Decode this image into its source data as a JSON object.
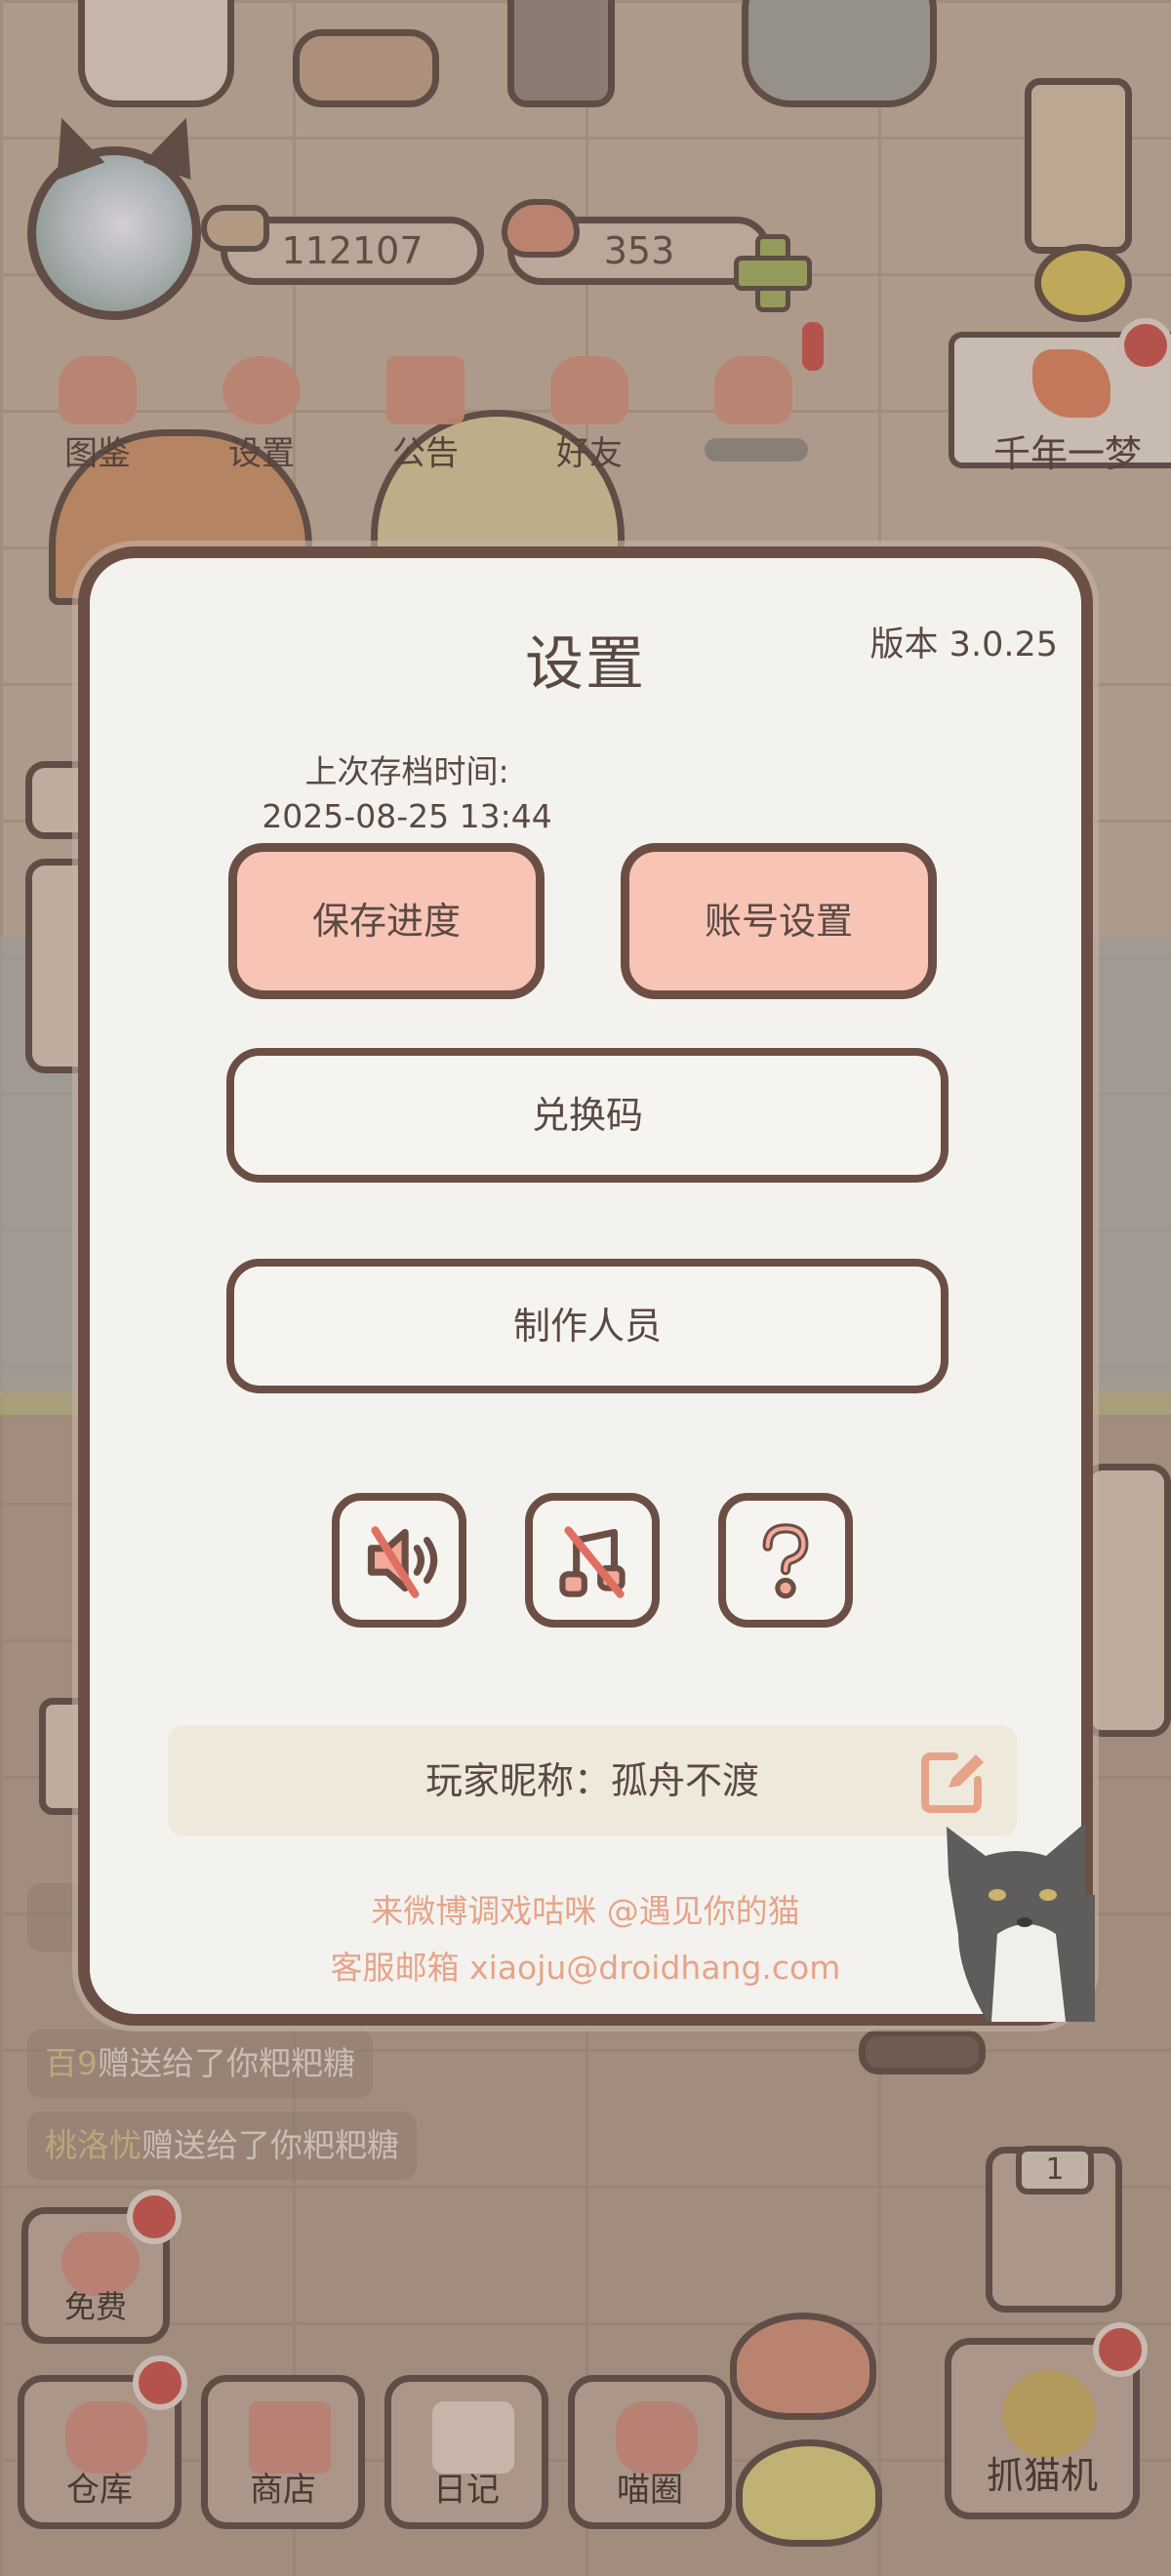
{
  "hud": {
    "coins": "112107",
    "hearts": "353"
  },
  "top_nav": [
    {
      "label": "图鉴"
    },
    {
      "label": "设置"
    },
    {
      "label": "公告"
    },
    {
      "label": "好友"
    }
  ],
  "event_banner": {
    "label": "千年一梦"
  },
  "chat": [
    {
      "name": "百9",
      "text": "赠送给了你粑粑糖"
    },
    {
      "name": "桃洛忧",
      "text": "赠送给了你粑粑糖"
    }
  ],
  "side_button": {
    "label": "免费"
  },
  "bottom_nav": [
    {
      "label": "仓库"
    },
    {
      "label": "商店"
    },
    {
      "label": "日记"
    },
    {
      "label": "喵圈"
    }
  ],
  "claw_machine": {
    "label": "抓猫机",
    "count": "1"
  },
  "settings": {
    "title": "设置",
    "version": "版本 3.0.25",
    "last_save_label": "上次存档时间:",
    "last_save_time": "2025-08-25 13:44",
    "save_button": "保存进度",
    "account_button": "账号设置",
    "redeem_button": "兑换码",
    "credits_button": "制作人员",
    "icons": [
      "sound-off-icon",
      "music-off-icon",
      "help-icon"
    ],
    "nickname": "玩家昵称：孤舟不渡",
    "weibo": "来微博调戏咕咪 @遇见你的猫",
    "support_email": "客服邮箱 xiaoju@droidhang.com"
  },
  "colors": {
    "accent_pink": "#f7c4b6",
    "border_brown": "#6b4f45",
    "footer_text": "#e5a48a",
    "badge_red": "#c1504a"
  }
}
